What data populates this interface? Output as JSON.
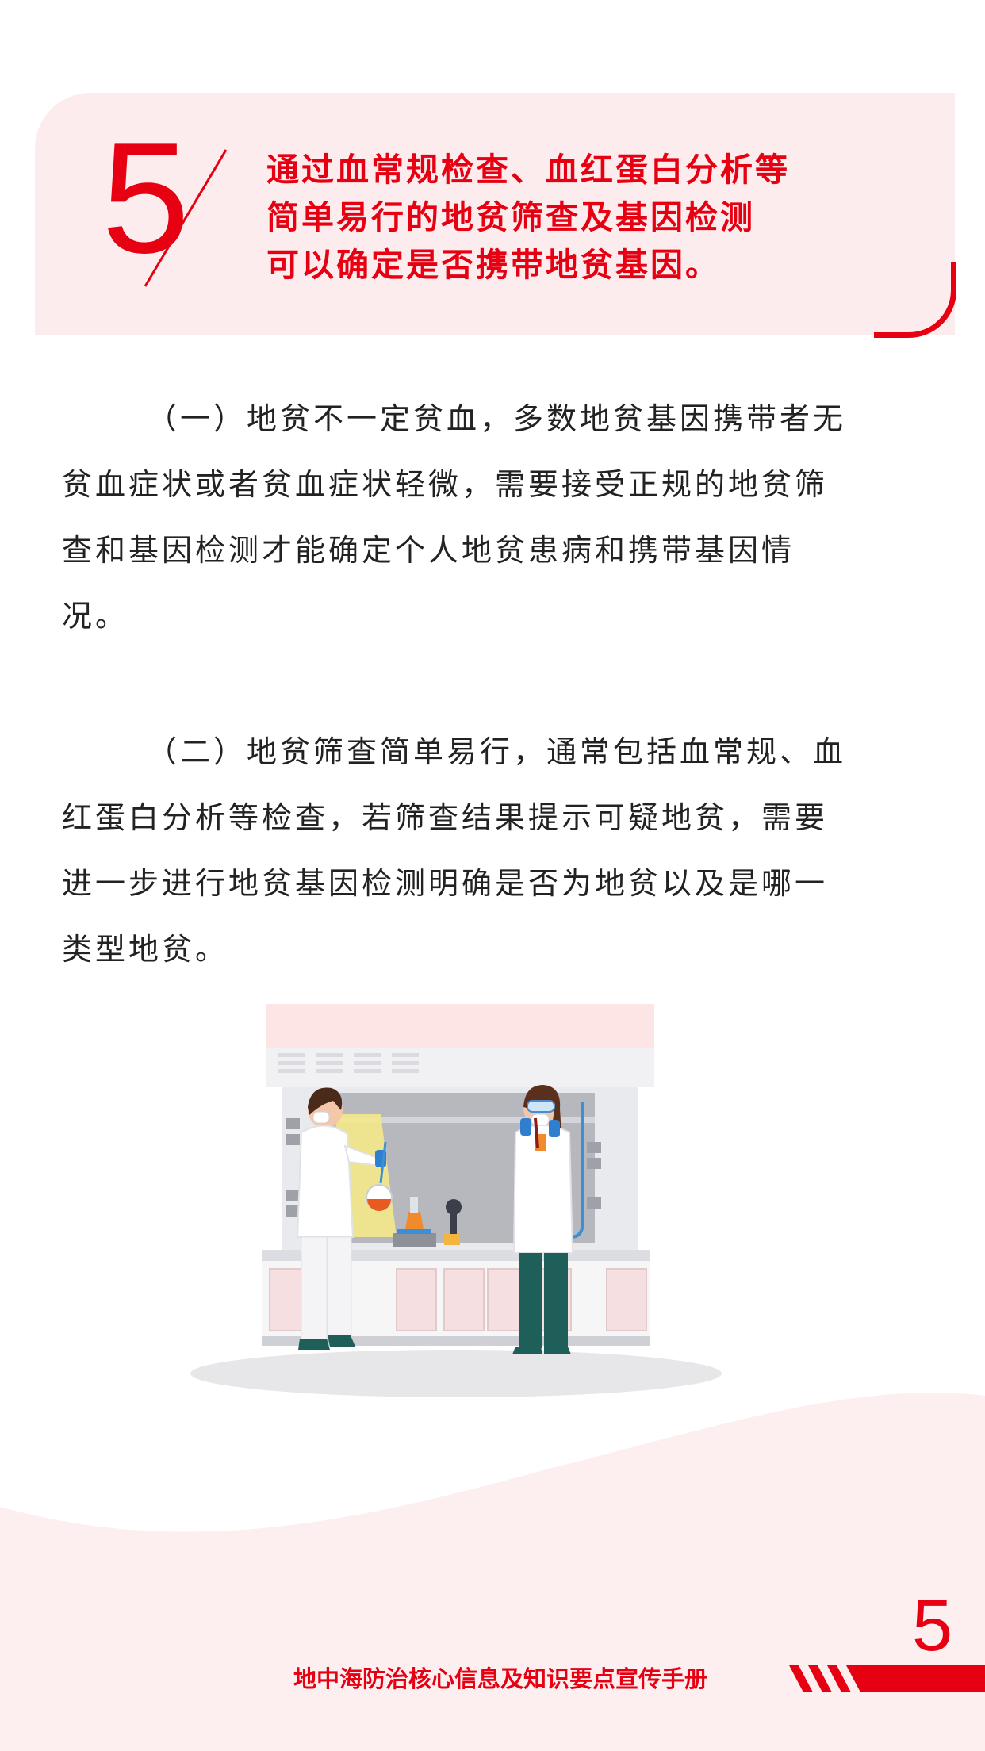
{
  "header": {
    "number": "5",
    "lines": [
      "通过血常规检查、血红蛋白分析等",
      "简单易行的地贫筛查及基因检测",
      "可以确定是否携带地贫基因。"
    ]
  },
  "sections": [
    {
      "lines": [
        "（一）地贫不一定贫血，多数地贫基因携带者无",
        "贫血症状或者贫血症状轻微，需要接受正规的地贫筛",
        "查和基因检测才能确定个人地贫患病和携带基因情",
        "况。"
      ]
    },
    {
      "lines": [
        "（二）地贫筛查简单易行，通常包括血常规、血",
        "红蛋白分析等检查，若筛查结果提示可疑地贫，需要",
        "进一步进行地贫基因检测明确是否为地贫以及是哪一",
        "类型地贫。"
      ]
    }
  ],
  "illustration": {
    "icon": "lab-scientists-illustration-icon"
  },
  "footer": {
    "page_number": "5",
    "title": "地中海防治核心信息及知识要点宣传手册"
  },
  "colors": {
    "accent": "#e60012",
    "card_bg": "#fdecee",
    "text": "#222222"
  }
}
